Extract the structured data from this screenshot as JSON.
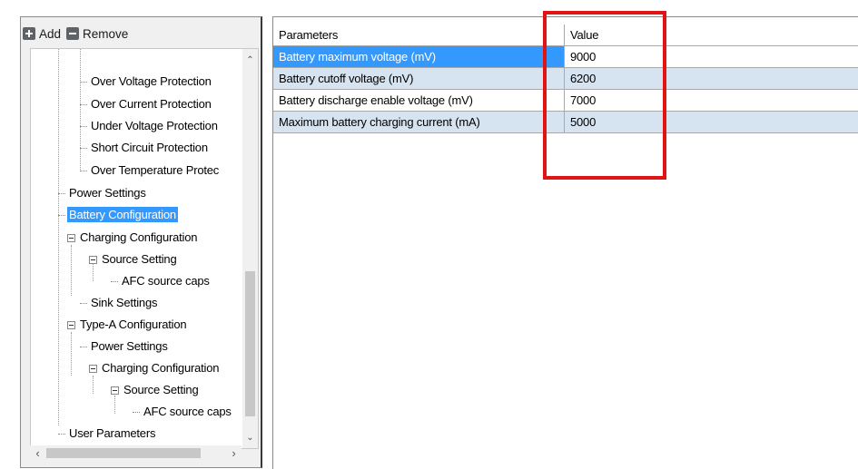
{
  "toolbar": {
    "add_label": "Add",
    "remove_label": "Remove"
  },
  "tree": {
    "items": [
      "Over Voltage Protection",
      "Over Current Protection",
      "Under Voltage Protection",
      "Short Circuit Protection",
      "Over Temperature Protec",
      "Power Settings",
      "Battery Configuration",
      "Charging Configuration",
      "Source Setting",
      "AFC source caps",
      "Sink Settings",
      "Type-A Configuration",
      "Power Settings",
      "Charging Configuration",
      "Source Setting",
      "AFC source caps",
      "User Parameters"
    ],
    "selected": "Battery Configuration"
  },
  "grid": {
    "headers": [
      "Parameters",
      "Value"
    ],
    "rows": [
      [
        "Battery maximum voltage (mV)",
        "9000"
      ],
      [
        "Battery cutoff voltage (mV)",
        "6200"
      ],
      [
        "Battery discharge enable voltage (mV)",
        "7000"
      ],
      [
        "Maximum battery charging current (mA)",
        "5000"
      ]
    ]
  },
  "colors": {
    "selection": "#3399ff",
    "alt_row": "#d6e3f0",
    "highlight_box": "#e01414"
  }
}
